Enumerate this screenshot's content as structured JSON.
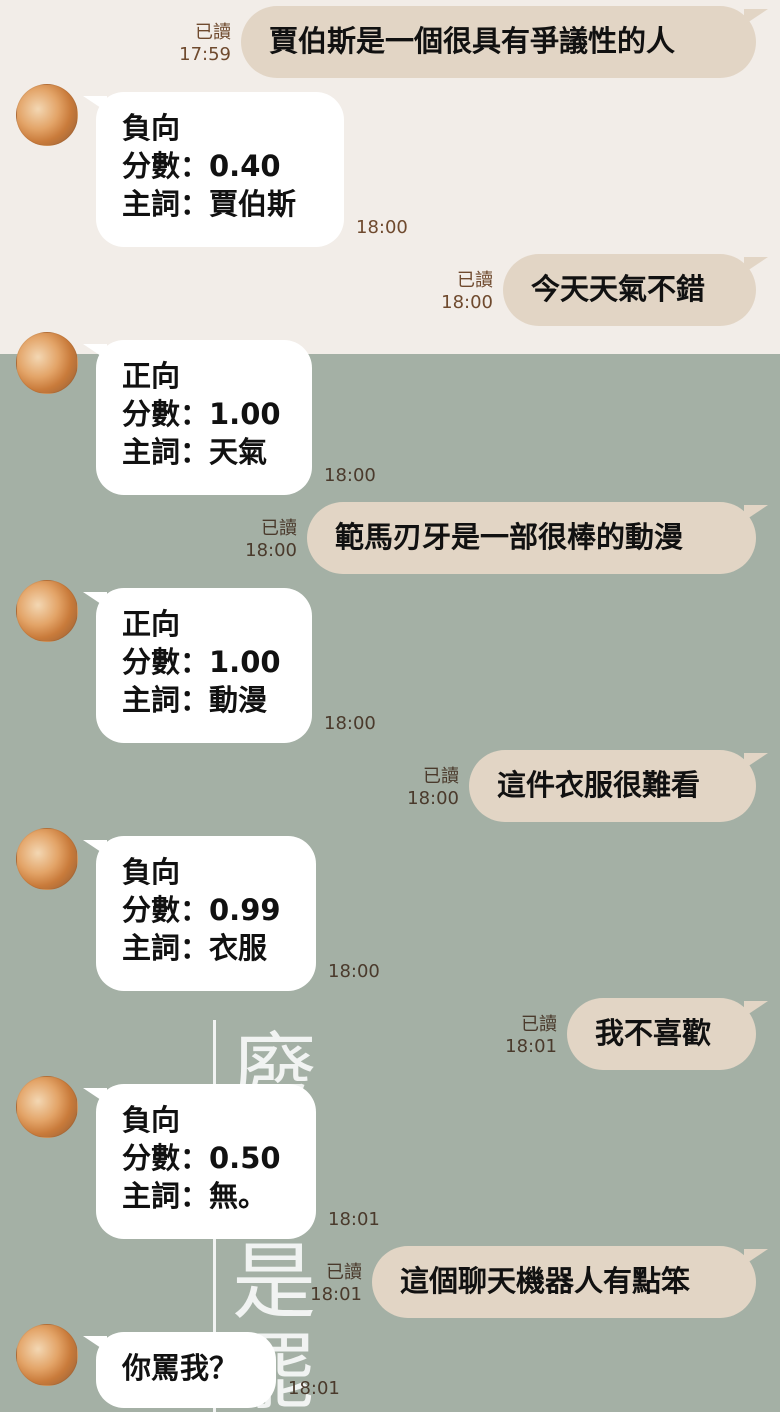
{
  "conversation": {
    "read_label": "已讀",
    "messages": [
      {
        "dir": "out",
        "text": "賈伯斯是一個很具有爭議性的人",
        "time": "17:59",
        "read": true
      },
      {
        "dir": "in",
        "lines": [
          "負向",
          "分數：0.40",
          "主詞：賈伯斯"
        ],
        "time": "18:00",
        "avatar_icon": "cat-avatar-icon"
      },
      {
        "dir": "out",
        "text": "今天天氣不錯",
        "time": "18:00",
        "read": true
      },
      {
        "dir": "in",
        "lines": [
          "正向",
          "分數：1.00",
          "主詞：天氣"
        ],
        "time": "18:00",
        "avatar_icon": "cat-avatar-icon"
      },
      {
        "dir": "out",
        "text": "範馬刃牙是一部很棒的動漫",
        "time": "18:00",
        "read": true
      },
      {
        "dir": "in",
        "lines": [
          "正向",
          "分數：1.00",
          "主詞：動漫"
        ],
        "time": "18:00",
        "avatar_icon": "cat-avatar-icon"
      },
      {
        "dir": "out",
        "text": "這件衣服很難看",
        "time": "18:00",
        "read": true
      },
      {
        "dir": "in",
        "lines": [
          "負向",
          "分數：0.99",
          "主詞：衣服"
        ],
        "time": "18:00",
        "avatar_icon": "cat-avatar-icon"
      },
      {
        "dir": "out",
        "text": "我不喜歡",
        "time": "18:01",
        "read": true
      },
      {
        "dir": "in",
        "lines": [
          "負向",
          "分數：0.50",
          "主詞：無。"
        ],
        "time": "18:01",
        "avatar_icon": "cat-avatar-icon"
      },
      {
        "dir": "out",
        "text": "這個聊天機器人有點笨",
        "time": "18:01",
        "read": true
      },
      {
        "dir": "in",
        "lines": [
          "你罵我？"
        ],
        "time": "18:01",
        "avatar_icon": "cat-avatar-icon"
      }
    ]
  },
  "wallpaper": {
    "chars": [
      "廢",
      "是",
      "罷"
    ],
    "colors": {
      "top": "#f2ede8",
      "bottom": "#a4b0a5"
    }
  },
  "colors": {
    "incoming_bubble": "#ffffff",
    "outgoing_bubble": "#e2d5c5",
    "meta_text": "#6f4a2e"
  }
}
